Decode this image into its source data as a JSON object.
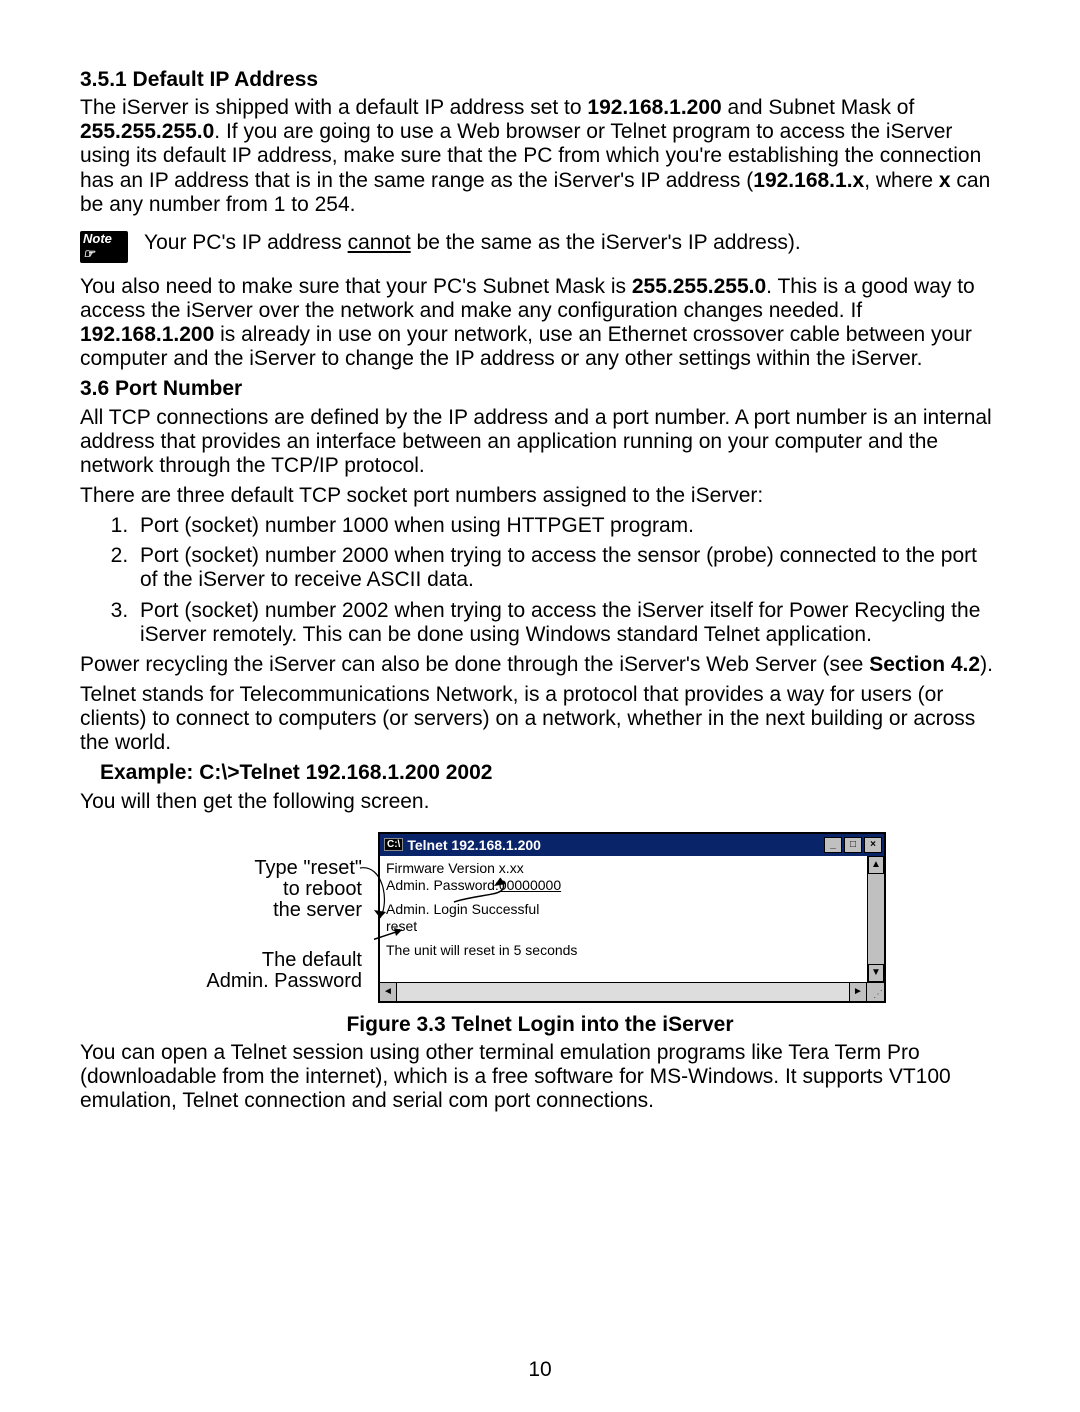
{
  "section351_heading": "3.5.1  Default IP Address",
  "p1a": "The iServer is shipped with a default IP address set to ",
  "p1b": "192.168.1.200",
  "p1c": " and Subnet Mask of ",
  "p1d": "255.255.255.0",
  "p1e": ".  If you are going to use a Web browser or Telnet program to access the iServer using its default IP address, make sure that the PC from which you're establishing the connection has an IP address that is in the same range as the iServer's IP address (",
  "p1f": "192.168.1.x",
  "p1g": ", where ",
  "p1h": "x",
  "p1i": " can be any number from 1 to 254.",
  "note_label": "Note",
  "note_a": "Your PC's IP address ",
  "note_under": "cannot",
  "note_b": " be the same as the iServer's IP address).",
  "p2a": "You also need to make sure that your PC's Subnet Mask is ",
  "p2b": "255.255.255.0",
  "p2c": ".  This is a good way to access the iServer over the network and make any configuration changes needed. If ",
  "p2d": "192.168.1.200",
  "p2e": " is already in use on your network, use an Ethernet crossover cable between your computer and the iServer to change the IP address or any other settings within the iServer.",
  "section36_heading": "3.6  Port Number",
  "p3": "All TCP connections are defined by the IP address and a port number. A port number is an internal address that provides an interface between an application running on your computer and the network through the TCP/IP protocol.",
  "p4": "There are three default TCP socket port numbers assigned to the iServer:",
  "li1": "Port (socket) number 1000 when using HTTPGET program.",
  "li2": "Port (socket) number 2000 when trying to access the sensor (probe) connected to the port of the iServer to receive ASCII data.",
  "li3": "Port (socket) number 2002 when trying to access the iServer itself for Power Recycling the iServer remotely.  This can be done using Windows standard Telnet application.",
  "p5a": "Power recycling the iServer can also be done through the iServer's Web Server (see ",
  "p5b": "Section 4.2",
  "p5c": ").",
  "p6": "Telnet stands for Telecommunications Network, is a protocol that provides a way for users (or clients) to connect to computers (or servers) on a network, whether in the next building or across the world.",
  "example": "Example:  C:\\>Telnet 192.168.1.200 2002",
  "p7": "You will then get the following screen.",
  "callout1": "Type \"reset\"\nto reboot\nthe server",
  "callout2": "The default\nAdmin. Password",
  "telnet_title_icon": "C:\\",
  "telnet_title": "Telnet 192.168.1.200",
  "telnet_line1": "Firmware Version x.xx",
  "telnet_line2a": "Admin. Password:",
  "telnet_line2b": "00000000",
  "telnet_line3": "Admin. Login Successful",
  "telnet_line4": "reset",
  "telnet_line5": "The unit will reset in 5 seconds",
  "fig_caption": "Figure 3.3  Telnet Login into the iServer",
  "p8": "You can open a Telnet session using other terminal emulation programs like Tera Term Pro (downloadable from the internet), which is a free software for MS-Windows. It supports VT100 emulation, Telnet connection and serial com port connections.",
  "page_number": "10"
}
